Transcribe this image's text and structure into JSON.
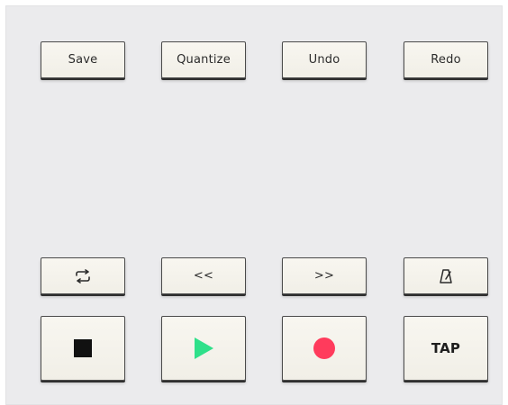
{
  "top_row": {
    "save_label": "Save",
    "quantize_label": "Quantize",
    "undo_label": "Undo",
    "redo_label": "Redo"
  },
  "transport_small": {
    "loop_icon": "loop-icon",
    "rewind_label": "<<",
    "forward_label": ">>",
    "metronome_icon": "metronome-icon"
  },
  "transport_large": {
    "stop_icon": "stop-icon",
    "play_icon": "play-icon",
    "record_icon": "record-icon",
    "tap_label": "TAP"
  },
  "colors": {
    "panel_bg": "#ebebed",
    "button_face": "#f5f3ec",
    "button_border": "#4a4a4a",
    "stop_color": "#111111",
    "play_color": "#2fe08a",
    "record_color": "#ff3b5c"
  }
}
